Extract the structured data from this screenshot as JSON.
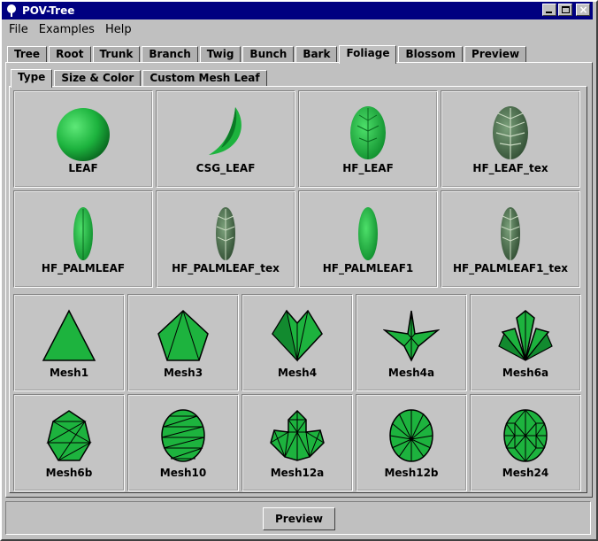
{
  "window": {
    "title": "POV-Tree",
    "icon": "tree-icon"
  },
  "menu": [
    "File",
    "Examples",
    "Help"
  ],
  "main_tabs": [
    "Tree",
    "Root",
    "Trunk",
    "Branch",
    "Twig",
    "Bunch",
    "Bark",
    "Foliage",
    "Blossom",
    "Preview"
  ],
  "main_tab_selected": "Foliage",
  "sub_tabs": [
    "Type",
    "Size & Color",
    "Custom Mesh Leaf"
  ],
  "sub_tab_selected": "Type",
  "hf_leaves": [
    "LEAF",
    "CSG_LEAF",
    "HF_LEAF",
    "HF_LEAF_tex",
    "HF_PALMLEAF",
    "HF_PALMLEAF_tex",
    "HF_PALMLEAF1",
    "HF_PALMLEAF1_tex"
  ],
  "mesh_leaves": [
    "Mesh1",
    "Mesh3",
    "Mesh4",
    "Mesh4a",
    "Mesh6a",
    "Mesh6b",
    "Mesh10",
    "Mesh12a",
    "Mesh12b",
    "Mesh24"
  ],
  "footer": {
    "preview_label": "Preview"
  },
  "colors": {
    "leaf_green": "#1db33e",
    "title_bar": "#000080"
  }
}
